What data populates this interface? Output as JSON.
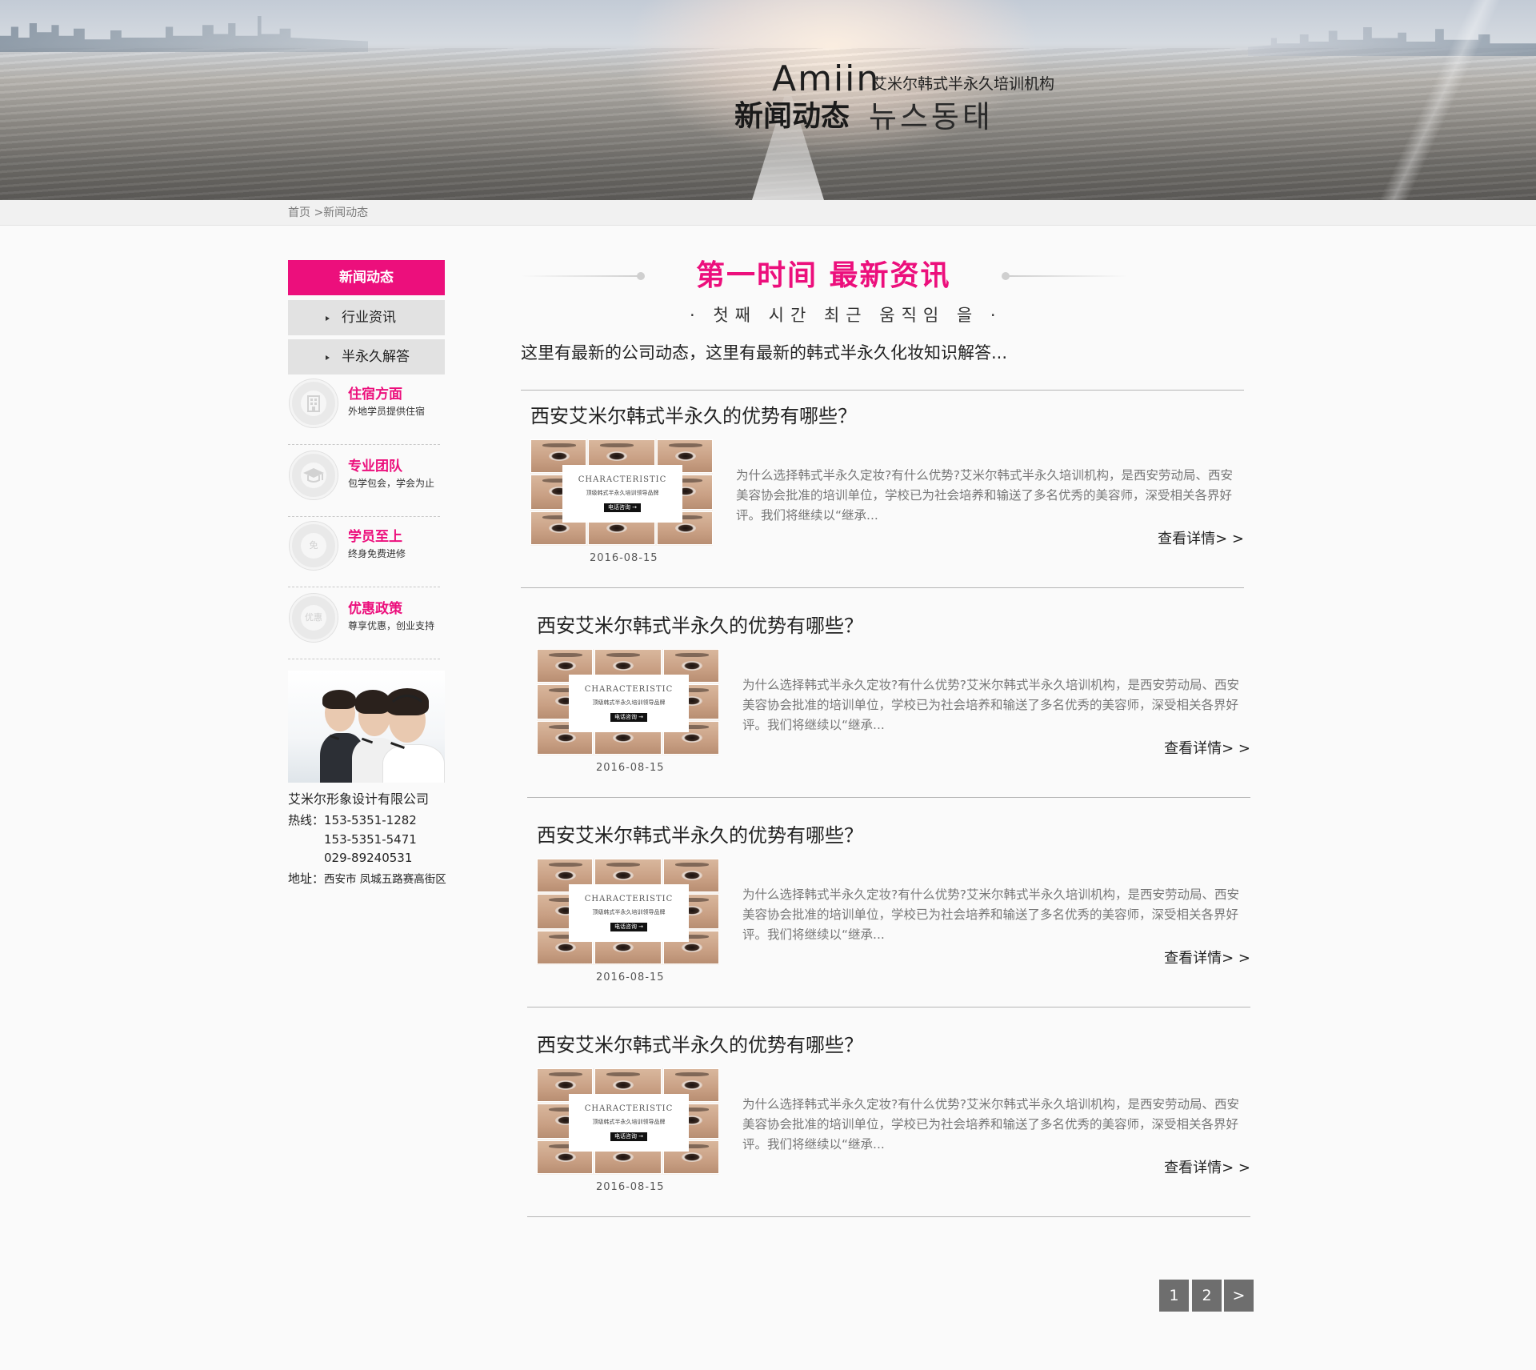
{
  "banner": {
    "brand_en": "Amiin",
    "brand_cn": "艾米尔韩式半永久培训机构",
    "title_cn": "新闻动态",
    "title_kr": "뉴스동태"
  },
  "breadcrumb": {
    "home": "首页",
    "separator": " >",
    "current": "新闻动态"
  },
  "sidebar": {
    "heading": "新闻动态",
    "items": [
      {
        "label": "行业资讯"
      },
      {
        "label": "半永久解答"
      }
    ],
    "features": [
      {
        "title": "住宿方面",
        "subtitle": "外地学员提供住宿",
        "icon": "building-icon",
        "icon_text": ""
      },
      {
        "title": "专业团队",
        "subtitle": "包学包会，学会为止",
        "icon": "graduation-cap-icon",
        "icon_text": ""
      },
      {
        "title": "学员至上",
        "subtitle": "终身免费进修",
        "icon": "free-icon",
        "icon_text": "免"
      },
      {
        "title": "优惠政策",
        "subtitle": "尊享优惠，创业支持",
        "icon": "discount-icon",
        "icon_text": "优惠"
      }
    ],
    "company": "艾米尔形象设计有限公司",
    "hotline_label": "热线：",
    "phones": [
      "153-5351-1282",
      "153-5351-5471",
      "029-89240531"
    ],
    "address_label": "地址：",
    "address": "西安市 凤城五路赛高街区"
  },
  "main": {
    "title": "第一时间  最新资讯",
    "subtitle_kr": "· 첫째 시간 최근 움직임 을 ·",
    "intro": "这里有最新的公司动态，这里有最新的韩式半永久化妆知识解答..."
  },
  "articles": [
    {
      "title": "西安艾米尔韩式半永久的优势有哪些？",
      "thumb_heading": "CHARACTERISTIC",
      "thumb_line": "顶级韩式半永久培训领导品牌",
      "thumb_button": "电话咨询 →",
      "date": "2016-08-15",
      "desc": "为什么选择韩式半永久定妆?有什么优势?艾米尔韩式半永久培训机构，是西安劳动局、西安美容协会批准的培训单位，学校已为社会培养和输送了多名优秀的美容师，深受相关各界好评。我们将继续以“继承...",
      "more": "查看详情> >"
    },
    {
      "title": "西安艾米尔韩式半永久的优势有哪些？",
      "thumb_heading": "CHARACTERISTIC",
      "thumb_line": "顶级韩式半永久培训领导品牌",
      "thumb_button": "电话咨询 →",
      "date": "2016-08-15",
      "desc": "为什么选择韩式半永久定妆?有什么优势?艾米尔韩式半永久培训机构，是西安劳动局、西安美容协会批准的培训单位，学校已为社会培养和输送了多名优秀的美容师，深受相关各界好评。我们将继续以“继承...",
      "more": "查看详情> >"
    },
    {
      "title": "西安艾米尔韩式半永久的优势有哪些？",
      "thumb_heading": "CHARACTERISTIC",
      "thumb_line": "顶级韩式半永久培训领导品牌",
      "thumb_button": "电话咨询 →",
      "date": "2016-08-15",
      "desc": "为什么选择韩式半永久定妆?有什么优势?艾米尔韩式半永久培训机构，是西安劳动局、西安美容协会批准的培训单位，学校已为社会培养和输送了多名优秀的美容师，深受相关各界好评。我们将继续以“继承...",
      "more": "查看详情> >"
    },
    {
      "title": "西安艾米尔韩式半永久的优势有哪些？",
      "thumb_heading": "CHARACTERISTIC",
      "thumb_line": "顶级韩式半永久培训领导品牌",
      "thumb_button": "电话咨询 →",
      "date": "2016-08-15",
      "desc": "为什么选择韩式半永久定妆?有什么优势?艾米尔韩式半永久培训机构，是西安劳动局、西安美容协会批准的培训单位，学校已为社会培养和输送了多名优秀的美容师，深受相关各界好评。我们将继续以“继承...",
      "more": "查看详情> >"
    }
  ],
  "pagination": {
    "pages": [
      "1",
      "2"
    ],
    "next": ">"
  },
  "colors": {
    "accent": "#ec0f7c",
    "sidebar_item_bg": "#e2e2e2",
    "pager_bg": "#6e6e6e"
  }
}
